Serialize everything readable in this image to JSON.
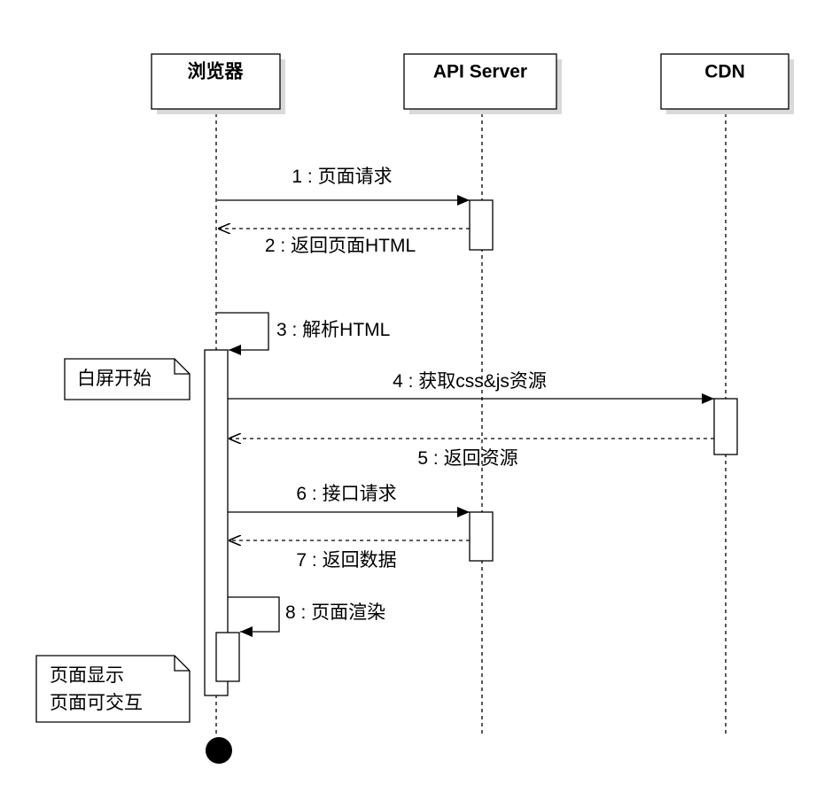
{
  "participants": [
    {
      "id": "browser",
      "label": "浏览器"
    },
    {
      "id": "api",
      "label": "API Server"
    },
    {
      "id": "cdn",
      "label": "CDN"
    }
  ],
  "messages": [
    {
      "index": 1,
      "label": "1 : 页面请求",
      "from": "browser",
      "to": "api",
      "kind": "sync"
    },
    {
      "index": 2,
      "label": "2 : 返回页面HTML",
      "from": "api",
      "to": "browser",
      "kind": "return"
    },
    {
      "index": 3,
      "label": "3 : 解析HTML",
      "from": "browser",
      "to": "browser",
      "kind": "self"
    },
    {
      "index": 4,
      "label": "4 : 获取css&js资源",
      "from": "browser",
      "to": "cdn",
      "kind": "sync"
    },
    {
      "index": 5,
      "label": "5 : 返回资源",
      "from": "cdn",
      "to": "browser",
      "kind": "return"
    },
    {
      "index": 6,
      "label": "6 : 接口请求",
      "from": "browser",
      "to": "api",
      "kind": "sync"
    },
    {
      "index": 7,
      "label": "7 : 返回数据",
      "from": "api",
      "to": "browser",
      "kind": "return"
    },
    {
      "index": 8,
      "label": "8 : 页面渲染",
      "from": "browser",
      "to": "browser",
      "kind": "self"
    }
  ],
  "notes": [
    {
      "id": "white-screen-start",
      "lines": [
        "白屏开始"
      ]
    },
    {
      "id": "page-display",
      "lines": [
        "页面显示",
        "页面可交互"
      ]
    }
  ],
  "colors": {
    "stroke": "#000000",
    "fill": "#ffffff",
    "shadow": "#d9d9d9"
  }
}
